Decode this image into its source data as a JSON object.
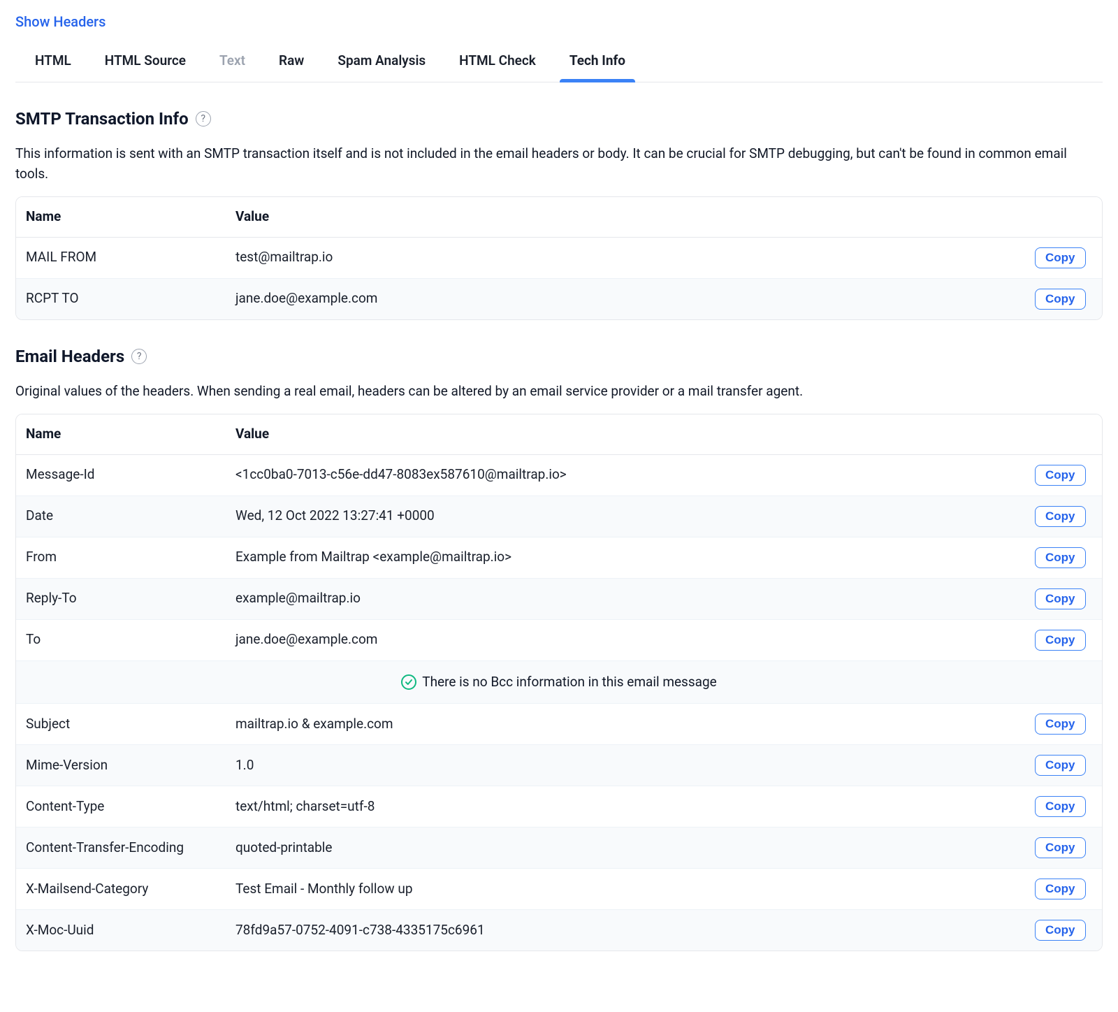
{
  "header": {
    "show_headers_link": "Show Headers"
  },
  "tabs": {
    "items": [
      {
        "label": "HTML",
        "muted": false,
        "active": false
      },
      {
        "label": "HTML Source",
        "muted": false,
        "active": false
      },
      {
        "label": "Text",
        "muted": true,
        "active": false
      },
      {
        "label": "Raw",
        "muted": false,
        "active": false
      },
      {
        "label": "Spam Analysis",
        "muted": false,
        "active": false
      },
      {
        "label": "HTML Check",
        "muted": false,
        "active": false
      },
      {
        "label": "Tech Info",
        "muted": false,
        "active": true
      }
    ]
  },
  "common": {
    "copy_label": "Copy",
    "col_name": "Name",
    "col_value": "Value"
  },
  "smtp": {
    "title": "SMTP Transaction Info",
    "description": "This information is sent with an SMTP transaction itself and is not included in the email headers or body. It can be crucial for SMTP debugging, but can't be found in common email tools.",
    "rows": [
      {
        "name": "MAIL FROM",
        "value": "test@mailtrap.io"
      },
      {
        "name": "RCPT TO",
        "value": "jane.doe@example.com"
      }
    ]
  },
  "headers": {
    "title": "Email Headers",
    "description": "Original values of the headers. When sending a real email, headers can be altered by an email service provider or a mail transfer agent.",
    "bcc_notice": "There is no Bcc information in this email message",
    "rows_top": [
      {
        "name": "Message-Id",
        "value": "<1cc0ba0-7013-c56e-dd47-8083ex587610@mailtrap.io>"
      },
      {
        "name": "Date",
        "value": "Wed, 12 Oct 2022 13:27:41 +0000"
      },
      {
        "name": "From",
        "value": "Example from Mailtrap <example@mailtrap.io>"
      },
      {
        "name": "Reply-To",
        "value": "example@mailtrap.io"
      },
      {
        "name": "To",
        "value": "jane.doe@example.com"
      }
    ],
    "rows_bottom": [
      {
        "name": "Subject",
        "value": "mailtrap.io & example.com"
      },
      {
        "name": "Mime-Version",
        "value": "1.0"
      },
      {
        "name": "Content-Type",
        "value": "text/html; charset=utf-8"
      },
      {
        "name": "Content-Transfer-Encoding",
        "value": "quoted-printable"
      },
      {
        "name": "X-Mailsend-Category",
        "value": "Test Email - Monthly follow up"
      },
      {
        "name": "X-Moc-Uuid",
        "value": "78fd9a57-0752-4091-c738-4335175c6961"
      }
    ]
  }
}
